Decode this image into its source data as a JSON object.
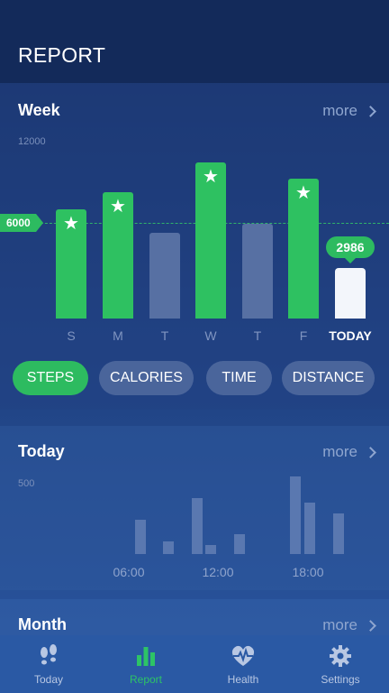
{
  "header": {
    "title": "REPORT"
  },
  "week": {
    "title": "Week",
    "more_label": "more",
    "y_max_label": "12000",
    "goal_label": "6000",
    "today_value": "2986",
    "tabs": [
      {
        "label": "STEPS",
        "active": true
      },
      {
        "label": "CALORIES",
        "active": false
      },
      {
        "label": "TIME",
        "active": false
      },
      {
        "label": "DISTANCE",
        "active": false
      }
    ]
  },
  "today_section": {
    "title": "Today",
    "more_label": "more",
    "y_label": "500",
    "time_labels": [
      "06:00",
      "12:00",
      "18:00"
    ]
  },
  "month_section": {
    "title": "Month",
    "more_label": "more"
  },
  "nav": {
    "items": [
      {
        "label": "Today",
        "icon": "footprints-icon",
        "active": false
      },
      {
        "label": "Report",
        "icon": "bar-chart-icon",
        "active": true
      },
      {
        "label": "Health",
        "icon": "heart-pulse-icon",
        "active": false
      },
      {
        "label": "Settings",
        "icon": "gear-icon",
        "active": false
      }
    ]
  },
  "colors": {
    "accent_green": "#2dbb60",
    "inactive_bar": "#5770a3",
    "background": "#1e3f7e"
  },
  "chart_data": [
    {
      "type": "bar",
      "categories": [
        "S",
        "M",
        "T",
        "W",
        "T",
        "F",
        "TODAY"
      ],
      "values": [
        7400,
        8600,
        5800,
        10600,
        6400,
        9500,
        3400
      ],
      "goal": 6000,
      "ylim": [
        0,
        12000
      ],
      "goal_met": [
        true,
        true,
        false,
        true,
        false,
        true,
        false
      ],
      "ylabel": "",
      "xlabel": ""
    },
    {
      "type": "bar",
      "x": [
        4,
        5,
        6,
        7,
        8,
        9,
        10,
        11,
        12,
        13,
        14,
        15,
        16,
        17,
        18,
        19,
        20,
        21,
        22
      ],
      "values": [
        0,
        0,
        0,
        220,
        0,
        80,
        0,
        360,
        60,
        0,
        130,
        0,
        0,
        0,
        500,
        330,
        0,
        260,
        0
      ],
      "ylim": [
        0,
        500
      ],
      "x_tick_labels": [
        "06:00",
        "12:00",
        "18:00"
      ],
      "ylabel": "",
      "xlabel": ""
    }
  ]
}
